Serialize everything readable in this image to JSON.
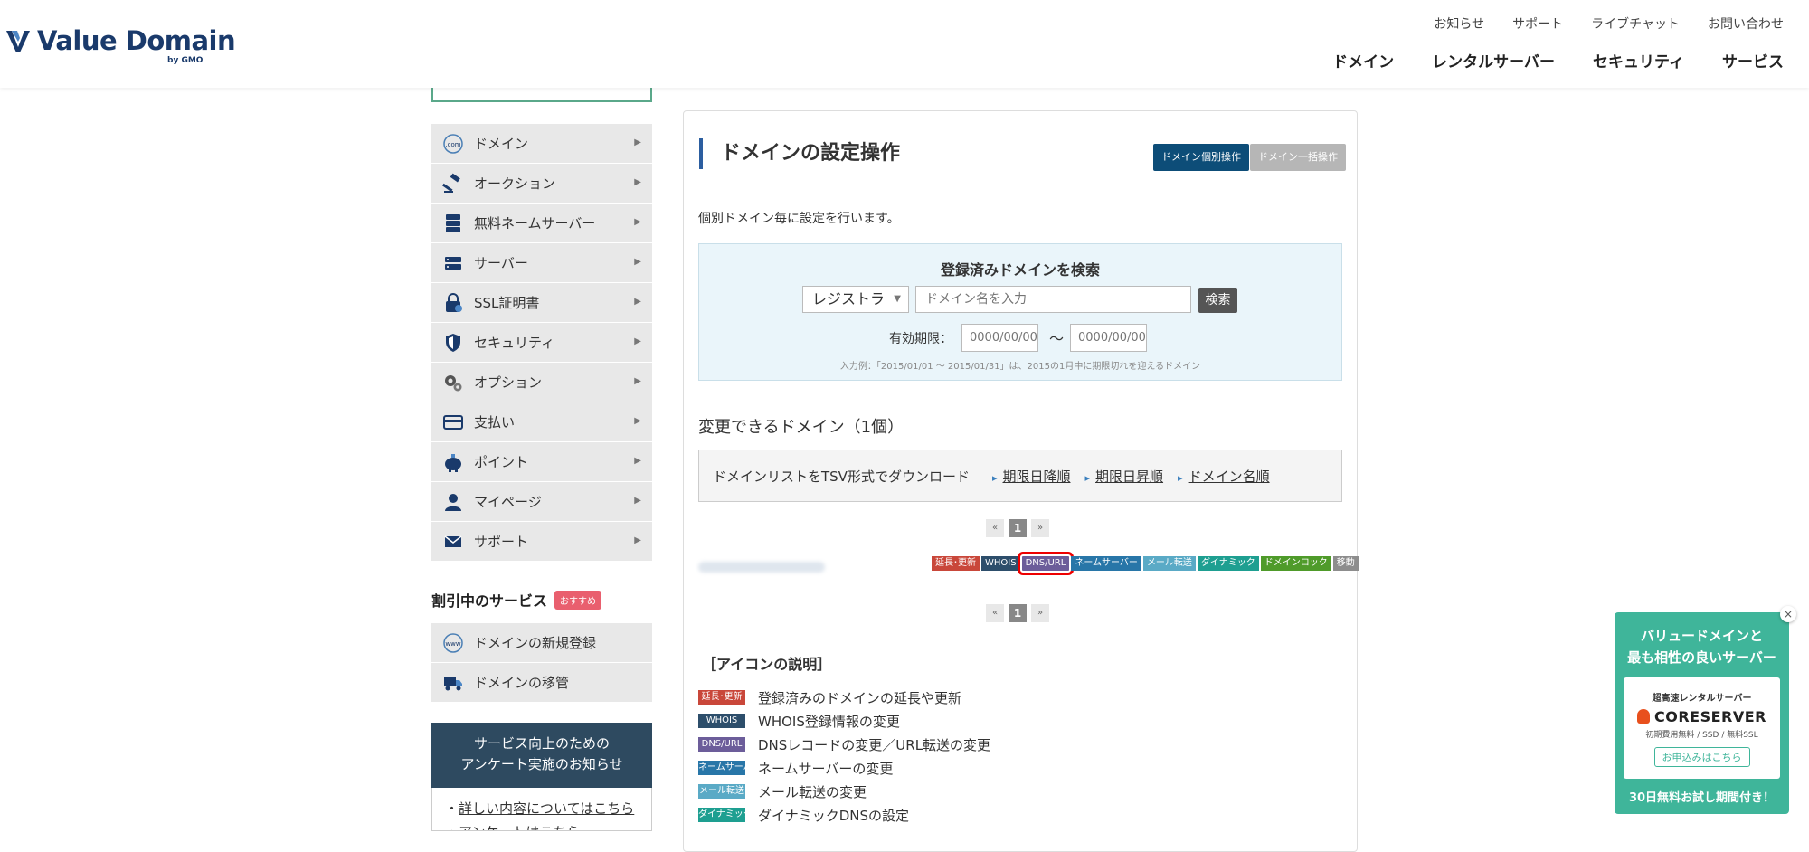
{
  "brand": {
    "name": "Value Domain",
    "sub": "by GMO"
  },
  "utility_nav": [
    "お知らせ",
    "サポート",
    "ライブチャット",
    "お問い合わせ"
  ],
  "main_nav": [
    "ドメイン",
    "レンタルサーバー",
    "セキュリティ",
    "サービス"
  ],
  "sidebar": {
    "menu": [
      {
        "label": "ドメイン",
        "icon": "dotcom-icon"
      },
      {
        "label": "オークション",
        "icon": "gavel-icon"
      },
      {
        "label": "無料ネームサーバー",
        "icon": "nameserver-icon"
      },
      {
        "label": "サーバー",
        "icon": "server-icon"
      },
      {
        "label": "SSL証明書",
        "icon": "ssl-lock-icon"
      },
      {
        "label": "セキュリティ",
        "icon": "shield-icon"
      },
      {
        "label": "オプション",
        "icon": "gears-icon"
      },
      {
        "label": "支払い",
        "icon": "credit-card-icon"
      },
      {
        "label": "ポイント",
        "icon": "piggy-bank-icon"
      },
      {
        "label": "マイページ",
        "icon": "user-icon"
      },
      {
        "label": "サポート",
        "icon": "mail-icon"
      }
    ],
    "discount_title": "割引中のサービス",
    "recommend_badge": "おすすめ",
    "discount_items": [
      {
        "label": "ドメインの新規登録",
        "icon": "www-icon"
      },
      {
        "label": "ドメインの移管",
        "icon": "truck-icon"
      }
    ],
    "survey_line1": "サービス向上のための",
    "survey_line2": "アンケート実施のお知らせ",
    "survey_links": [
      "詳しい内容についてはこちら",
      "アンケートはこちら"
    ]
  },
  "main": {
    "title": "ドメインの設定操作",
    "btn_individual": "ドメイン個別操作",
    "btn_bulk": "ドメイン一括操作",
    "description": "個別ドメイン毎に設定を行います。",
    "search": {
      "title": "登録済みドメインを検索",
      "select_value": "レジストラ",
      "input_placeholder": "ドメイン名を入力",
      "button": "検索",
      "expiry_label": "有効期限：",
      "date_placeholder": "0000/00/00",
      "tilde": "〜",
      "example": "入力例：「2015/01/01 ～ 2015/01/31」は、2015の1月中に期限切れを迎えるドメイン"
    },
    "changeable_heading": "変更できるドメイン（1個）",
    "tsv": {
      "label": "ドメインリストをTSV形式でダウンロード",
      "links": [
        "期限日降順",
        "期限日昇順",
        "ドメイン名順"
      ]
    },
    "pager": {
      "prev": "«",
      "current": "1",
      "next": "»"
    },
    "domain_row": {
      "tags": [
        {
          "label": "延長･更新",
          "color": "#c9473a"
        },
        {
          "label": "WHOIS",
          "color": "#2d4e6b"
        },
        {
          "label": "DNS/URL",
          "color": "#6c5d9a",
          "selected": true
        },
        {
          "label": "ネームサーバー",
          "color": "#2876a8"
        },
        {
          "label": "メール転送",
          "color": "#5aaac6"
        },
        {
          "label": "ダイナミック",
          "color": "#1e9f91"
        },
        {
          "label": "ドメインロック",
          "color": "#4f9b2a"
        },
        {
          "label": "移動",
          "color": "#8d8d8d"
        }
      ]
    },
    "icons_title": "［アイコンの説明］",
    "legend": [
      {
        "tag": "延長･更新",
        "color": "#c9473a",
        "text": "登録済みのドメインの延長や更新"
      },
      {
        "tag": "WHOIS",
        "color": "#2d4e6b",
        "text": "WHOIS登録情報の変更"
      },
      {
        "tag": "DNS/URL",
        "color": "#6c5d9a",
        "text": "DNSレコードの変更／URL転送の変更"
      },
      {
        "tag": "ネームサーバー",
        "color": "#2876a8",
        "text": "ネームサーバーの変更"
      },
      {
        "tag": "メール転送",
        "color": "#5aaac6",
        "text": "メール転送の変更"
      },
      {
        "tag": "ダイナミック",
        "color": "#1e9f91",
        "text": "ダイナミックDNSの設定"
      }
    ]
  },
  "promo": {
    "line1": "バリュードメインと",
    "line2": "最も相性の良いサーバー",
    "card_line1": "超高速レンタルサーバー",
    "card_brand": "CORESERVER",
    "card_line3": "初期費用無料 / SSD / 無料SSL",
    "card_button": "お申込みはこちら",
    "footer": "30日無料お試し期間付き！",
    "close": "×"
  }
}
